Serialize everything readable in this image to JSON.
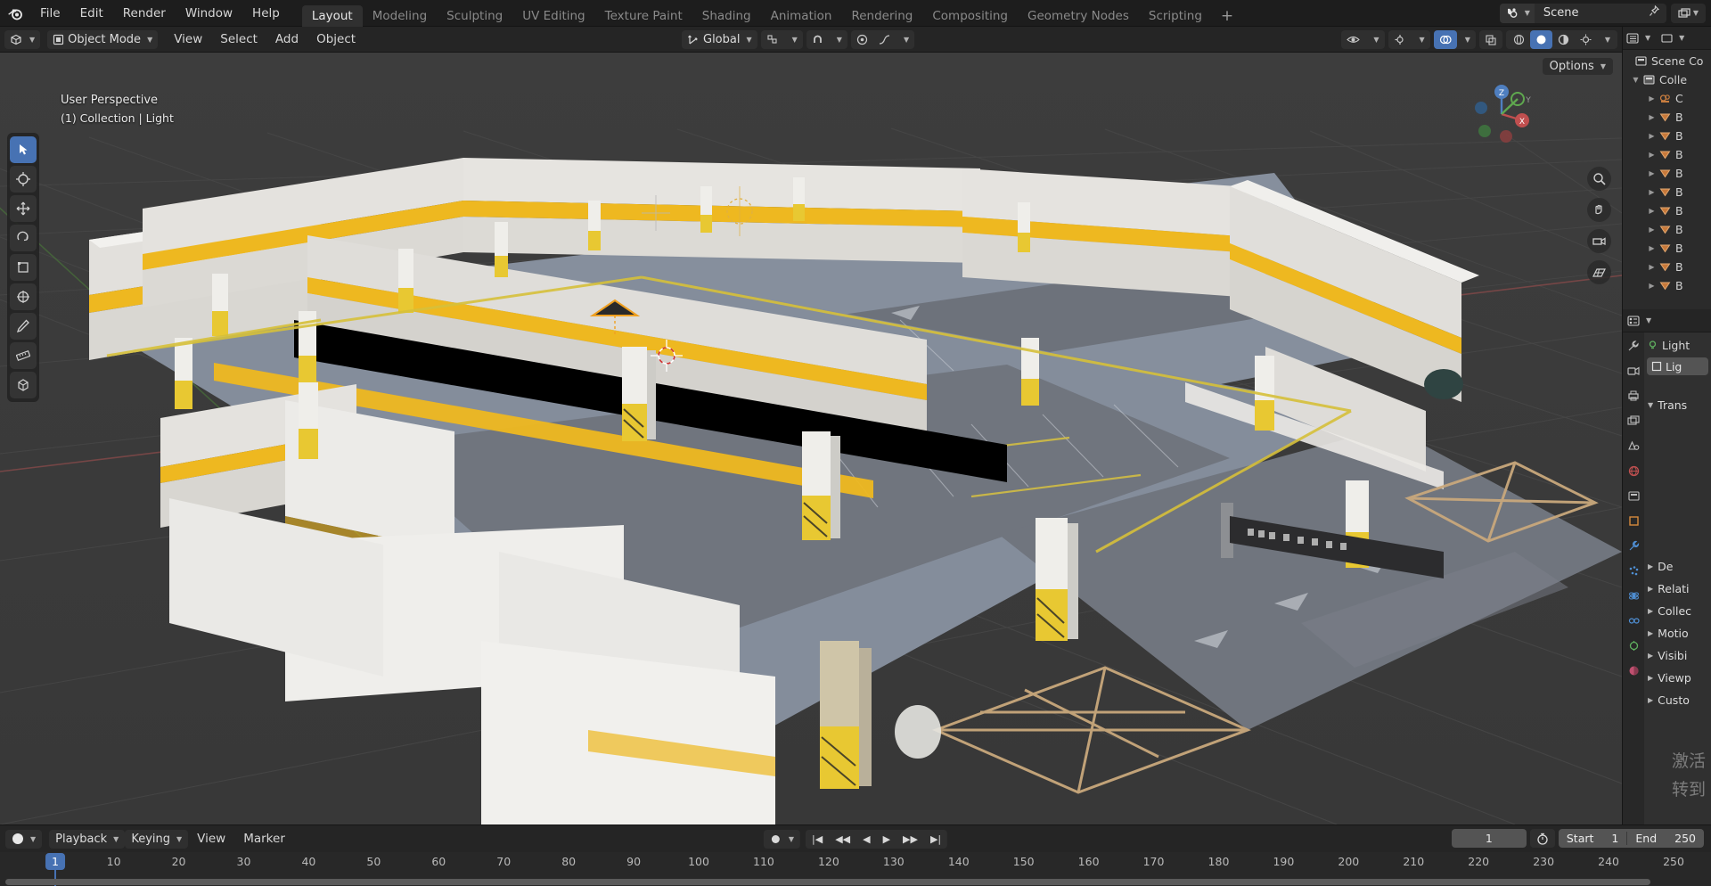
{
  "app": {
    "logo_icon": "blender-logo",
    "menus": [
      "File",
      "Edit",
      "Render",
      "Window",
      "Help"
    ],
    "workspace_tabs": [
      {
        "label": "Layout",
        "active": true
      },
      {
        "label": "Modeling",
        "active": false
      },
      {
        "label": "Sculpting",
        "active": false
      },
      {
        "label": "UV Editing",
        "active": false
      },
      {
        "label": "Texture Paint",
        "active": false
      },
      {
        "label": "Shading",
        "active": false
      },
      {
        "label": "Animation",
        "active": false
      },
      {
        "label": "Rendering",
        "active": false
      },
      {
        "label": "Compositing",
        "active": false
      },
      {
        "label": "Geometry Nodes",
        "active": false
      },
      {
        "label": "Scripting",
        "active": false
      }
    ],
    "add_workspace_label": "+",
    "scene": {
      "icon": "scene-icon",
      "name": "Scene",
      "pin_icon": "pin-icon"
    },
    "view_layer": {
      "icon": "view-layer-icon",
      "name": ""
    }
  },
  "viewport_header": {
    "editor_type_icon": "editor-type-3dview-icon",
    "mode": "Object Mode",
    "mode_icon": "object-mode-icon",
    "menus": [
      "View",
      "Select",
      "Add",
      "Object"
    ],
    "transform_orientation": {
      "icon": "orientation-icon",
      "value": "Global"
    },
    "snap_icon": "snap-magnet-icon",
    "snap_target_icon": "snap-increment-icon",
    "proportional_icon": "proportional-edit-icon",
    "falloff_icon": "falloff-smooth-icon",
    "visibility_icon": "eye-icon",
    "gizmo_icon": "gizmo-icon",
    "overlays_icon": "overlays-icon",
    "xray_icon": "xray-icon",
    "shading_modes": [
      "wireframe",
      "solid",
      "material-preview",
      "rendered"
    ],
    "shading_active_index": 1
  },
  "viewport": {
    "overlay_line1": "User Perspective",
    "overlay_line2": "(1) Collection | Light",
    "options_label": "Options",
    "toolbar_tools": [
      {
        "name": "tweak-select-box-tool",
        "icon": "cursor-box-select",
        "active": true
      },
      {
        "name": "cursor-tool",
        "icon": "3d-cursor"
      },
      {
        "name": "move-tool",
        "icon": "move-arrows"
      },
      {
        "name": "rotate-tool",
        "icon": "rotate-arc"
      },
      {
        "name": "scale-tool",
        "icon": "scale-corner"
      },
      {
        "name": "transform-tool",
        "icon": "transform-combined"
      },
      {
        "name": "annotate-tool",
        "icon": "pencil"
      },
      {
        "name": "measure-tool",
        "icon": "ruler"
      },
      {
        "name": "add-cube-tool",
        "icon": "cube-add"
      }
    ],
    "nav_buttons": [
      {
        "name": "zoom-nav-button",
        "icon": "magnifier"
      },
      {
        "name": "pan-nav-button",
        "icon": "hand"
      },
      {
        "name": "camera-view-button",
        "icon": "camera"
      },
      {
        "name": "toggle-ortho-button",
        "icon": "grid"
      }
    ],
    "gizmo_axes": {
      "x": "X",
      "y": "Y",
      "z": "Z"
    },
    "colors": {
      "background": "#3a3a3a",
      "grid_line": "#4a4a4a",
      "axis_x": "#b24a4a",
      "axis_y": "#5aa64a",
      "model_concrete": "#d8d6d2",
      "model_yellow": "#e8c832",
      "model_floor": "#8a94a3",
      "model_road": "#6e737c",
      "model_wood": "#d8b894",
      "accent_blue": "#4772b3"
    }
  },
  "outliner": {
    "header_icons": [
      "editor-type-outliner-icon",
      "display-mode-icon",
      "filter-icon",
      "search-icon"
    ],
    "rows": [
      {
        "indent": 0,
        "tri": "",
        "icon": "scene-collection-icon",
        "label": "Scene Co"
      },
      {
        "indent": 1,
        "tri": "▼",
        "icon": "collection-icon",
        "label": "Colle"
      },
      {
        "indent": 2,
        "tri": "▶",
        "icon": "camera-data-icon",
        "label": "C"
      },
      {
        "indent": 2,
        "tri": "▶",
        "icon": "mesh-data-icon",
        "label": "B"
      },
      {
        "indent": 2,
        "tri": "▶",
        "icon": "mesh-data-icon",
        "label": "B"
      },
      {
        "indent": 2,
        "tri": "▶",
        "icon": "mesh-data-icon",
        "label": "B"
      },
      {
        "indent": 2,
        "tri": "▶",
        "icon": "mesh-data-icon",
        "label": "B"
      },
      {
        "indent": 2,
        "tri": "▶",
        "icon": "mesh-data-icon",
        "label": "B"
      },
      {
        "indent": 2,
        "tri": "▶",
        "icon": "mesh-data-icon",
        "label": "B"
      },
      {
        "indent": 2,
        "tri": "▶",
        "icon": "mesh-data-icon",
        "label": "B"
      },
      {
        "indent": 2,
        "tri": "▶",
        "icon": "mesh-data-icon",
        "label": "B"
      },
      {
        "indent": 2,
        "tri": "▶",
        "icon": "mesh-data-icon",
        "label": "B"
      },
      {
        "indent": 2,
        "tri": "▶",
        "icon": "mesh-data-icon",
        "label": "B"
      }
    ]
  },
  "properties": {
    "header_icons": [
      "editor-type-properties-icon",
      "filter-icon"
    ],
    "breadcrumb": [
      {
        "icon": "light-data-icon",
        "label": "Light"
      }
    ],
    "object_field": {
      "icon": "object-icon",
      "label": "Lig"
    },
    "panels": [
      {
        "tri": "▼",
        "label": "Trans"
      },
      {
        "tri": "▶",
        "label": "De"
      },
      {
        "tri": "▶",
        "label": "Relati"
      },
      {
        "tri": "▶",
        "label": "Collec"
      },
      {
        "tri": "▶",
        "label": "Motio"
      },
      {
        "tri": "▶",
        "label": "Visibi"
      },
      {
        "tri": "▶",
        "label": "Viewp"
      },
      {
        "tri": "▶",
        "label": "Custo"
      }
    ],
    "tabs": [
      {
        "name": "tool-tab",
        "icon": "wrench-screwdriver"
      },
      {
        "name": "render-tab",
        "icon": "camera-back"
      },
      {
        "name": "output-tab",
        "icon": "printer"
      },
      {
        "name": "view-layer-tab",
        "icon": "images"
      },
      {
        "name": "scene-tab",
        "icon": "cone-sphere"
      },
      {
        "name": "world-tab",
        "icon": "globe"
      },
      {
        "name": "collection-tab",
        "icon": "box"
      },
      {
        "name": "object-tab",
        "icon": "orange-square"
      },
      {
        "name": "modifiers-tab",
        "icon": "blue-wrench"
      },
      {
        "name": "particles-tab",
        "icon": "particles"
      },
      {
        "name": "physics-tab",
        "icon": "physics-orbit"
      },
      {
        "name": "constraints-tab",
        "icon": "constraint"
      },
      {
        "name": "data-tab",
        "icon": "green-data"
      },
      {
        "name": "material-tab",
        "icon": "checker-sphere"
      }
    ]
  },
  "timeline": {
    "editor_icon": "editor-type-timeline-icon",
    "menus": [
      {
        "label": "Playback",
        "has_caret": true
      },
      {
        "label": "Keying",
        "has_caret": true
      },
      {
        "label": "View",
        "has_caret": false
      },
      {
        "label": "Marker",
        "has_caret": false
      }
    ],
    "auto_keying_icon": "record-dot-icon",
    "transport": [
      {
        "name": "jump-to-start-button",
        "icon": "|◀"
      },
      {
        "name": "previous-keyframe-button",
        "icon": "◀◀"
      },
      {
        "name": "play-reverse-button",
        "icon": "◀"
      },
      {
        "name": "play-button",
        "icon": "▶"
      },
      {
        "name": "next-keyframe-button",
        "icon": "▶▶"
      },
      {
        "name": "jump-to-end-button",
        "icon": "▶|"
      }
    ],
    "current_frame": "1",
    "use_preview_range_icon": "stopwatch-icon",
    "start_label": "Start",
    "start_value": "1",
    "end_label": "End",
    "end_value": "250",
    "playhead_frame": "1",
    "ruler_ticks": [
      {
        "label": "1",
        "frame": 1
      },
      {
        "label": "10",
        "frame": 10
      },
      {
        "label": "20",
        "frame": 20
      },
      {
        "label": "30",
        "frame": 30
      },
      {
        "label": "40",
        "frame": 40
      },
      {
        "label": "50",
        "frame": 50
      },
      {
        "label": "60",
        "frame": 60
      },
      {
        "label": "70",
        "frame": 70
      },
      {
        "label": "80",
        "frame": 80
      },
      {
        "label": "90",
        "frame": 90
      },
      {
        "label": "100",
        "frame": 100
      },
      {
        "label": "110",
        "frame": 110
      },
      {
        "label": "120",
        "frame": 120
      },
      {
        "label": "130",
        "frame": 130
      },
      {
        "label": "140",
        "frame": 140
      },
      {
        "label": "150",
        "frame": 150
      },
      {
        "label": "160",
        "frame": 160
      },
      {
        "label": "170",
        "frame": 170
      },
      {
        "label": "180",
        "frame": 180
      },
      {
        "label": "190",
        "frame": 190
      },
      {
        "label": "200",
        "frame": 200
      },
      {
        "label": "210",
        "frame": 210
      },
      {
        "label": "220",
        "frame": 220
      },
      {
        "label": "230",
        "frame": 230
      },
      {
        "label": "240",
        "frame": 240
      },
      {
        "label": "250",
        "frame": 250
      }
    ]
  },
  "watermark": {
    "line1": "激活",
    "line2": "转到"
  }
}
